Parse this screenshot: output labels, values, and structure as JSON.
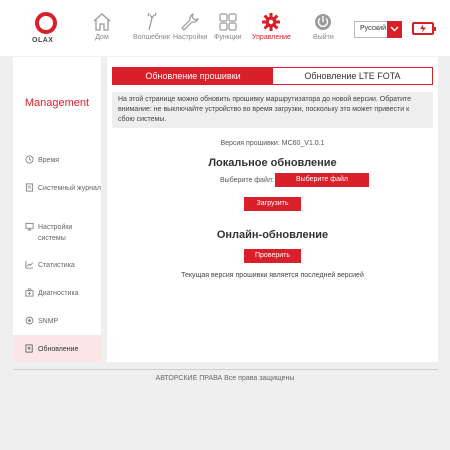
{
  "header": {
    "logo_text": "OLAX",
    "nav": [
      {
        "label": "Дом",
        "icon": "home-icon"
      },
      {
        "label": "Волшебник",
        "icon": "wand-icon"
      },
      {
        "label": "Настройки",
        "icon": "wrench-icon"
      },
      {
        "label": "Функции",
        "icon": "grid-icon"
      },
      {
        "label": "Управление",
        "icon": "gear-icon",
        "active": true
      },
      {
        "label": "Выйти",
        "icon": "power-icon"
      }
    ],
    "language": "Русский",
    "battery_icon": "battery-charging-icon"
  },
  "sidebar": {
    "title": "Management",
    "items": [
      {
        "label": "Время",
        "icon": "clock-icon"
      },
      {
        "label": "Системный журнал",
        "icon": "document-icon"
      },
      {
        "label": "Настройки системы",
        "icon": "monitor-icon"
      },
      {
        "label": "Статистика",
        "icon": "chart-icon"
      },
      {
        "label": "Диагностика",
        "icon": "medkit-icon"
      },
      {
        "label": "SNMP",
        "icon": "snmp-icon"
      },
      {
        "label": "Обновление",
        "icon": "update-icon",
        "active": true
      }
    ]
  },
  "main": {
    "tabs": [
      {
        "label": "Обновление прошивки",
        "active": true
      },
      {
        "label": "Обновление LTE FOTA",
        "active": false
      }
    ],
    "notice": "На этой странице можно обновить прошивку маршрутизатора до новой версии. Обратите внимание: не выключайте устройство во время загрузки, поскольку это может привести к сбою системы.",
    "firmware_version_label": "Версия прошивки:",
    "firmware_version_value": "MC60_V1.0.1",
    "local_update_title": "Локальное обновление",
    "choose_file_label": "Выберите файл:",
    "choose_file_button": "Выберите файл",
    "upload_button": "Загрузить",
    "online_update_title": "Онлайн-обновление",
    "check_button": "Проверить",
    "status_text": "Текущая версия прошивки является последней версией"
  },
  "footer": {
    "copyright": "АВТОРСКИЕ ПРАВА Все права защищены"
  },
  "colors": {
    "accent": "#d81f2a",
    "background": "#efefef",
    "panel": "#ffffff",
    "active_side": "#fbe6e7"
  }
}
